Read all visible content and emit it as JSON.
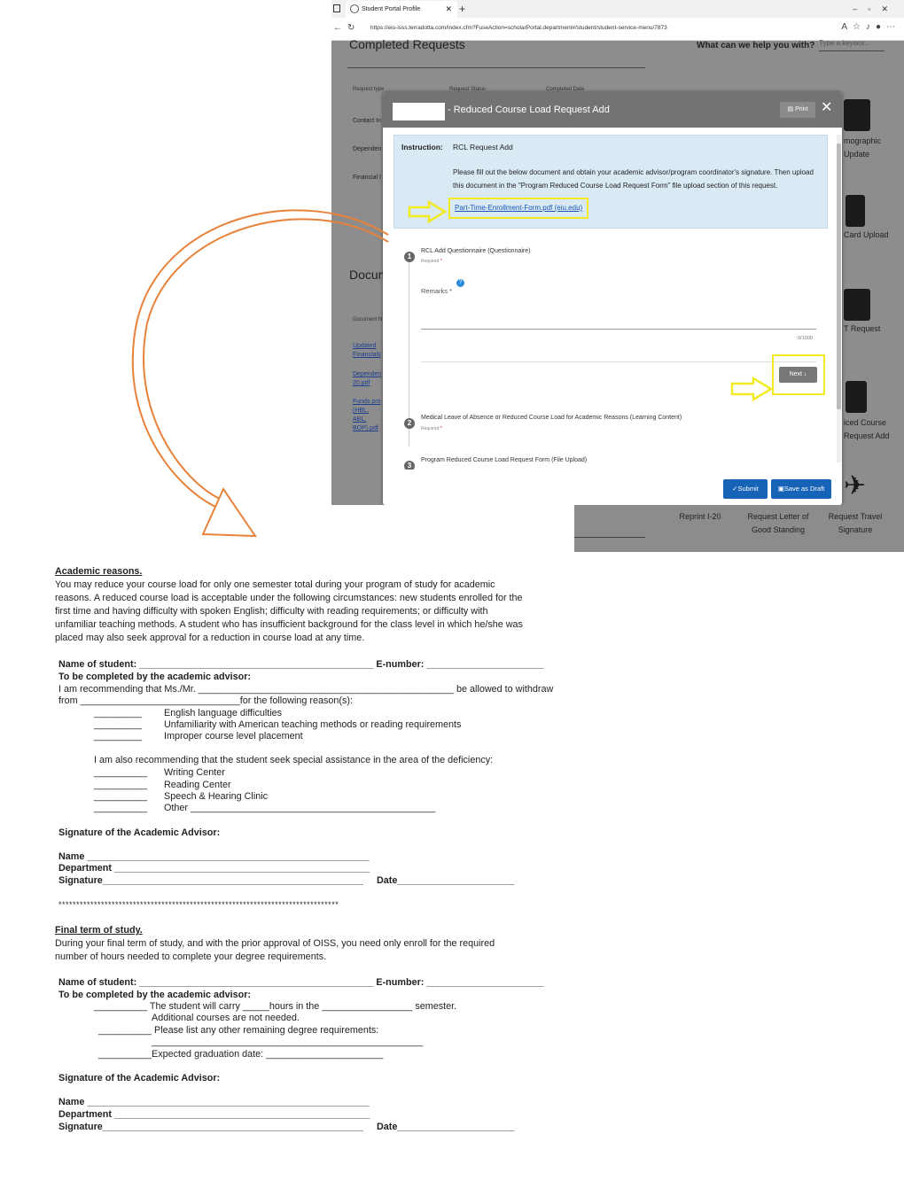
{
  "browser": {
    "tab_title": "Student Portal Profile",
    "url": "https://eiu-isss.terradotta.com/index.cfm?FuseAction=scholarPortal.department#/student/student-service-menu/7873"
  },
  "portal": {
    "completed_title": "Completed Requests",
    "help_text": "What can we help you with?",
    "search_placeholder": "Type a keywor...",
    "columns": [
      "Request type",
      "Request Status",
      "Completed Date"
    ],
    "rows": [
      "Contact In",
      "Dependen",
      "Financial I"
    ],
    "documents_title": "Docum",
    "doc_col": "Document N",
    "doc_links": [
      "Updated Financials",
      "Dependen 20.pdf",
      "Funds pro (HBL, ABL, BOP).pdf"
    ],
    "side_items": [
      "mographic Update",
      "Card Upload",
      "T Request",
      "iced Course Request Add"
    ],
    "bottom_tiles": [
      "Reprint I-20",
      "Request Letter of Good Standing",
      "Request Travel Signature"
    ]
  },
  "modal": {
    "title": "- Reduced Course Load Request Add",
    "print_label": "Print",
    "instruction_label": "Instruction:",
    "instruction_heading": "RCL Request Add",
    "instruction_text": "Please fill out the below document and obtain your academic advisor/program coordinator's signature.  Then upload this document in the \"Program Reduced Course Load Request Form\" file upload section of this request.",
    "link_text": "Part-Time-Enrollment-Form.pdf (eiu.edu)",
    "steps": [
      {
        "num": "1",
        "title": "RCL Add Questionnaire (Questionnaire)",
        "required": "Required"
      },
      {
        "num": "2",
        "title": "Medical Leave of Absence or Reduced Course Load for Academic Reasons (Learning Content)",
        "required": "Required"
      },
      {
        "num": "3",
        "title": "Program Reduced Course Load Request Form (File Upload)",
        "required": ""
      }
    ],
    "remarks_label": "Remarks",
    "counter": "0/1000",
    "next_label": "Next",
    "submit_label": "Submit",
    "draft_label": "Save as Draft"
  },
  "doc": {
    "s1_title": "Academic reasons.",
    "s1_para": "You may reduce your course load for only one semester total during your program of study for academic reasons. A reduced course load is acceptable under the following circumstances: new students enrolled for the first time and having difficulty with spoken English; difficulty with reading requirements; or difficulty with unfamiliar teaching methods. A student who has insufficient background for the class level in which he/she was placed may also seek approval for a reduction in course load at any time.",
    "name_line": "Name of student: ____________________________________________ E-number: ______________________",
    "advisor_line": "To be completed by the academic advisor:",
    "recommend_line": "I am recommending that Ms./Mr. ________________________________________________ be allowed to withdraw",
    "from_line": "from ______________________________for the following reason(s):",
    "reasons": [
      "English language difficulties",
      "Unfamiliarity with American teaching methods or reading requirements",
      "Improper course level placement"
    ],
    "assist_line": "I am also recommending that the student seek special assistance in the area of the deficiency:",
    "assist_items": [
      "Writing Center",
      "Reading Center",
      "Speech & Hearing Clinic",
      "Other ______________________________________________"
    ],
    "blank_short": "_________",
    "blank_med": "__________",
    "sig_title": "Signature of the Academic Advisor:",
    "sig_name": "Name _____________________________________________________",
    "sig_dept": "Department ________________________________________________",
    "sig_sig": "Signature_________________________________________________",
    "sig_date": "Date______________________",
    "stars": "*******************************************************************************",
    "s2_title": "Final term of study.",
    "s2_para": "During your final term of study, and with the prior approval of OISS, you need only enroll for the required number of hours needed to complete your degree requirements.",
    "carry_line": "__________  The student will carry _____hours in the _________________ semester.",
    "carry_line2": "Additional courses are not needed.",
    "remaining_line": "__________ Please list any other remaining degree requirements:",
    "remaining_blank": "___________________________________________________",
    "grad_line": "__________Expected graduation date: ______________________"
  }
}
